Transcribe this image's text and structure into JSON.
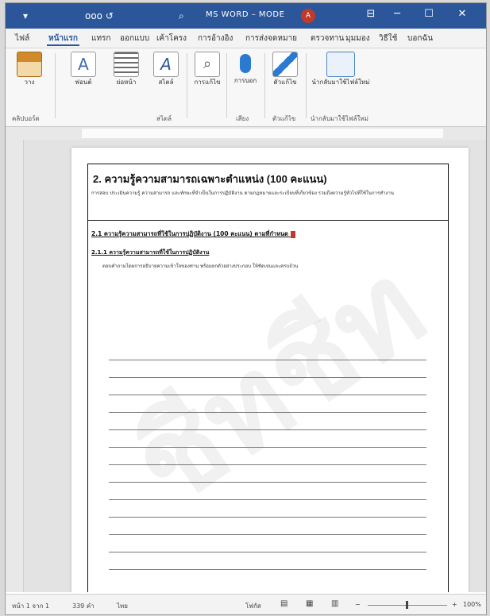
{
  "window": {
    "title": "MS WORD – MODE",
    "quick_access": [
      "▾",
      "ooo ↺",
      "⌕"
    ],
    "avatar_initial": "A",
    "controls": [
      "⊟",
      "─",
      "☐",
      "✕"
    ]
  },
  "menu": {
    "tabs": [
      "ไฟล์",
      "หน้าแรก",
      "แทรก",
      "ออกแบบ",
      "เค้าโครง",
      "การอ้างอิง",
      "การส่งจดหมาย",
      "ตรวจทาน",
      "มุมมอง",
      "วิธีใช้",
      "บอกฉัน"
    ],
    "active_index": 1
  },
  "ribbon": {
    "buttons": [
      {
        "label": "วาง",
        "icon": "paste-icon",
        "color": "#d08a2b"
      },
      {
        "label": "ฟอนต์",
        "icon": "font-icon",
        "color": "#3d6bb5"
      },
      {
        "label": "ย่อหน้า",
        "icon": "paragraph-icon",
        "color": "#6b6b6b"
      },
      {
        "label": "สไตล์",
        "icon": "styles-icon",
        "color": "#2b579a"
      },
      {
        "label": "การแก้ไข",
        "icon": "find-icon",
        "color": "#555555"
      },
      {
        "label": "การบอก",
        "icon": "microphone-icon",
        "color": "#2b79d0"
      },
      {
        "label": "ตัวแก้ไข",
        "icon": "editor-icon",
        "color": "#2b79d0"
      },
      {
        "label": "นำกลับมาใช้ไฟล์ใหม่",
        "icon": "reuse-files-icon",
        "color": "#4a86c5"
      }
    ],
    "groups": [
      "คลิปบอร์ด",
      "สไตล์",
      "เสียง",
      "ตัวแก้ไข",
      "นำกลับมาใช้ไฟล์ใหม่"
    ]
  },
  "document": {
    "heading": "2. ความรู้ความสามารถเฉพาะตำแหน่ง (100 คะแนน)",
    "intro": "การสอบ ประเมินความรู้ ความสามารถ และทักษะที่จำเป็นในการปฏิบัติงาน ตามกฎหมายและระเบียบที่เกี่ยวข้อง รวมถึงความรู้ทั่วไปที่ใช้ในการทำงาน",
    "section_title": "2.1 ความรู้ความสามารถที่ใช้ในการปฏิบัติงาน (100 คะแนน) ตามที่กำหนด",
    "sub_title": "2.1.1 ความรู้ความสามารถที่ใช้ในการปฏิบัติงาน",
    "body_line": "ตอบคำถามโดยการอธิบายความเข้าใจของท่าน พร้อมยกตัวอย่างประกอบ ให้ชัดเจนและครบถ้วน"
  },
  "status": {
    "page": "หน้า 1 จาก 1",
    "words": "339 คำ",
    "language": "ไทย",
    "focus": "โฟกัส",
    "zoom": "100%"
  },
  "watermark": "ชีทชีท"
}
